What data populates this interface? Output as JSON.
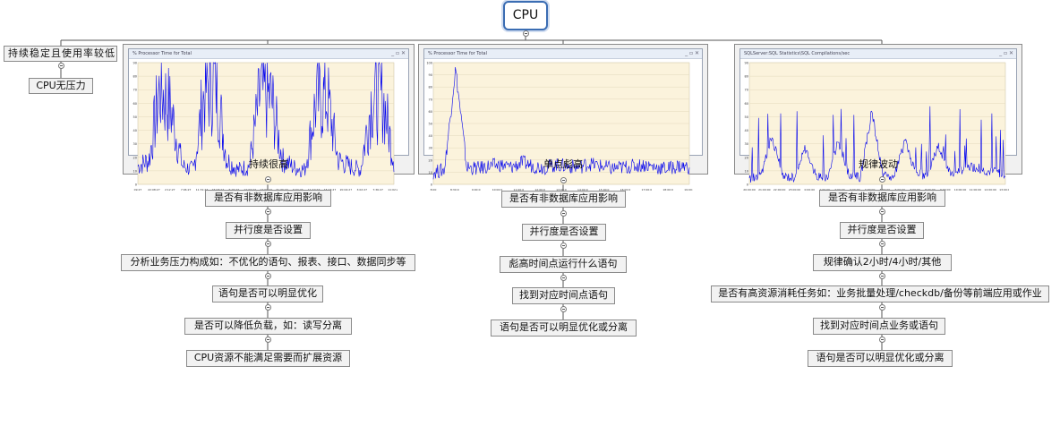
{
  "root": {
    "label": "CPU"
  },
  "left_branch": {
    "label": "持续稳定且使用率较低",
    "child": "CPU无压力"
  },
  "branches": [
    {
      "caption": "持续很高",
      "window_title": "% Processor Time for Total",
      "x_ticks": [
        "09:27",
        "22:08:27",
        "2:12:27",
        "7:06:27",
        "11:31:27",
        "16:03:27",
        "6:16:27",
        "12:03:27",
        "17:01:27",
        "21:30:27",
        "6:02:27",
        "11:19:27",
        "15:13:27",
        "20:04:27",
        "3:02:27",
        "7:36:27",
        "11:02:27"
      ],
      "y_ticks": [
        "90",
        "80",
        "70",
        "60",
        "50",
        "40",
        "30",
        "20",
        "10",
        "0"
      ],
      "steps": [
        "是否有非数据库应用影响",
        "并行度是否设置",
        "分析业务压力构成如：不优化的语句、报表、接口、数据同步等",
        "语句是否可以明显优化",
        "是否可以降低负载，如：读写分离",
        "CPU资源不能满足需要而扩展资源"
      ]
    },
    {
      "caption": "单点彪高",
      "window_title": "% Processor Time for Total",
      "x_ticks": [
        "8:00",
        "8:30:0",
        "9:00:0",
        "10:00:0",
        "11:00:0",
        "12:00:0",
        "13:00:0",
        "14:00:0",
        "15:00:0",
        "16:00:0",
        "17:00:0",
        "18:00:0",
        "19:00:0"
      ],
      "y_ticks": [
        "100",
        "90",
        "80",
        "70",
        "60",
        "50",
        "40",
        "30",
        "20",
        "10",
        "0"
      ],
      "steps": [
        "是否有非数据库应用影响",
        "并行度是否设置",
        "彪高时间点运行什么语句",
        "找到对应时间点语句",
        "语句是否可以明显优化或分离"
      ]
    },
    {
      "caption": "规律波动",
      "window_title": "SQLServer:SQL Statistics\\SQL Compilations/sec",
      "x_ticks": [
        "20:00:00",
        "21:00:00",
        "22:00:00",
        "23:00:00",
        "0:00:00",
        "1:00:00",
        "2:00:00",
        "3:00:00",
        "4:00:00",
        "5:00:00",
        "6:00:00",
        "7:00:00",
        "8:00:00",
        "9:00:00",
        "10:00:00",
        "11:00:00",
        "12:00:00",
        "13:00:00"
      ],
      "y_ticks": [
        "90",
        "80",
        "70",
        "60",
        "50",
        "40",
        "30",
        "20",
        "10",
        "0"
      ],
      "steps": [
        "是否有非数据库应用影响",
        "并行度是否设置",
        "规律确认2小时/4小时/其他",
        "是否有高资源消耗任务如：业务批量处理/checkdb/备份等前端应用或作业",
        "找到对应时间点业务或语句",
        "语句是否可以明显优化或分离"
      ]
    }
  ],
  "chart_data": [
    {
      "type": "line",
      "title": "% Processor Time for Total",
      "series": [
        {
          "values": [
            15,
            20,
            80,
            60,
            15,
            12,
            78,
            85,
            20,
            12,
            15,
            75,
            70,
            20,
            14,
            12,
            68,
            72,
            20,
            15,
            12,
            70,
            72,
            20
          ]
        }
      ],
      "ylim": [
        0,
        100
      ]
    },
    {
      "type": "line",
      "title": "% Processor Time for Total",
      "series": [
        {
          "values": [
            10,
            12,
            95,
            14,
            13,
            15,
            16,
            14,
            18,
            15,
            14,
            16,
            15,
            14,
            17,
            15,
            13,
            14,
            15,
            16,
            14,
            13,
            15,
            14
          ]
        }
      ],
      "ylim": [
        0,
        100
      ]
    },
    {
      "type": "line",
      "title": "SQLServer:SQL Statistics\\SQL Compilations/sec",
      "series": [
        {
          "values": [
            5,
            6,
            40,
            7,
            6,
            30,
            7,
            6,
            35,
            7,
            6,
            60,
            7,
            6,
            35,
            8,
            7,
            32,
            9,
            12,
            15,
            12,
            10,
            9
          ]
        }
      ],
      "ylim": [
        0,
        100
      ]
    }
  ],
  "colors": {
    "root_border": "#3b6db3",
    "series": "#0000ee",
    "plot_bg": "#fbf3dc",
    "plot_grid": "#e3d9bd"
  }
}
